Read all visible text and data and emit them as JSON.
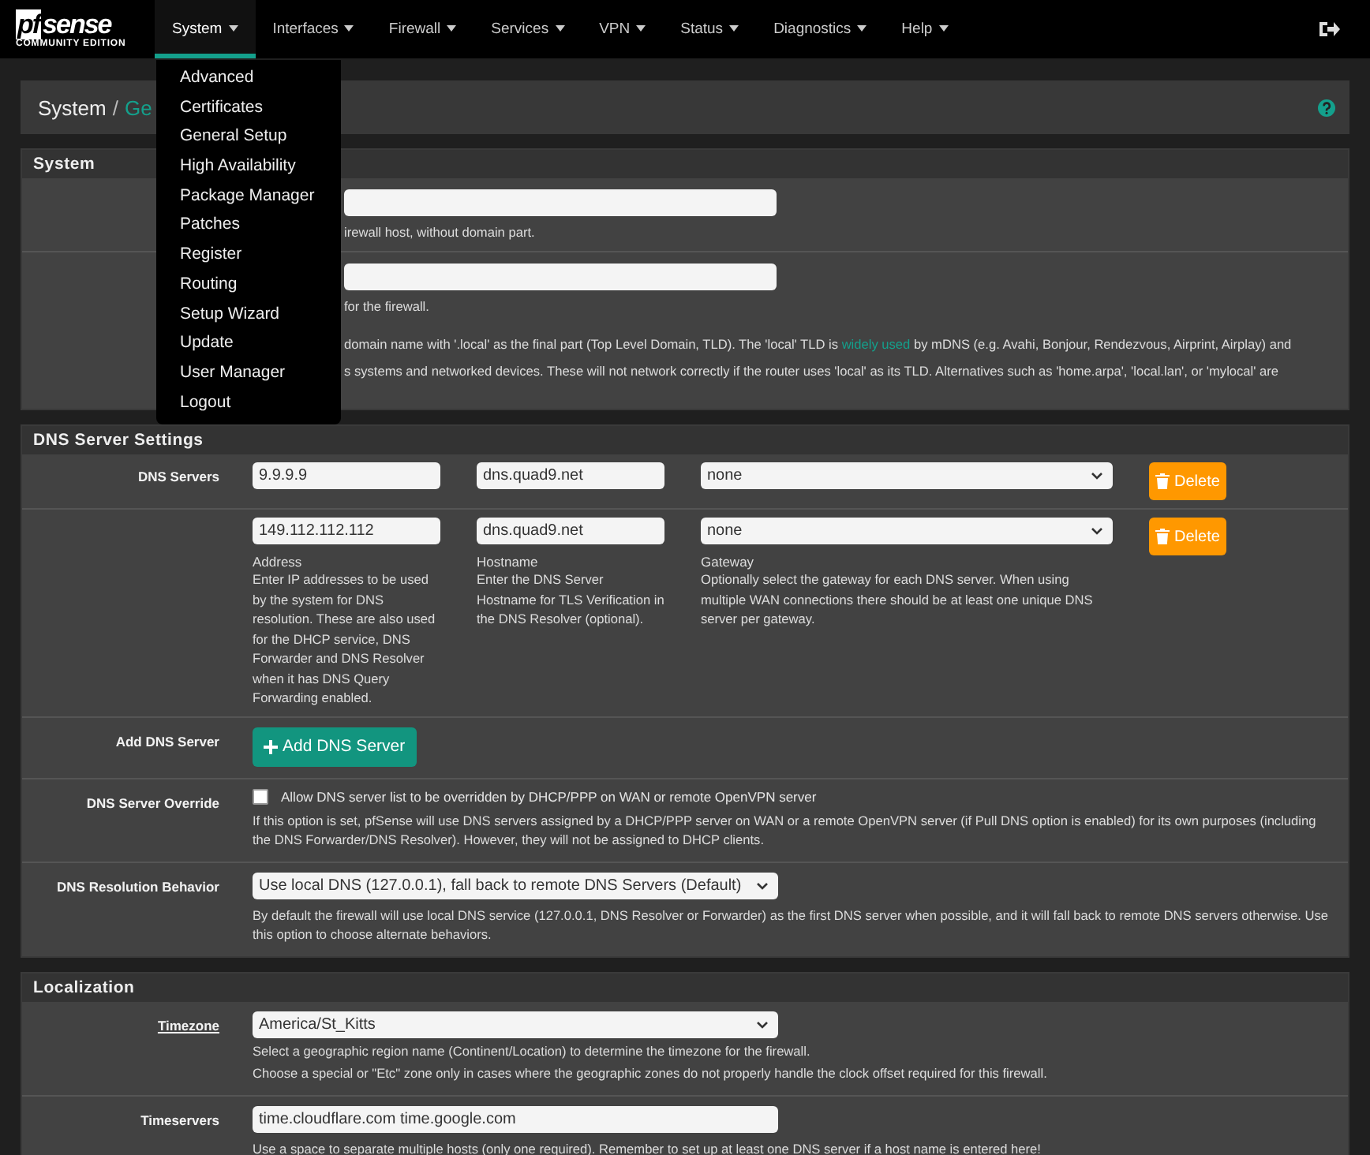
{
  "brand": {
    "logo_a": "pf",
    "logo_b": "sense",
    "edition": "COMMUNITY EDITION"
  },
  "navbar": {
    "items": [
      {
        "label": "System",
        "selected": true
      },
      {
        "label": "Interfaces",
        "selected": false
      },
      {
        "label": "Firewall",
        "selected": false
      },
      {
        "label": "Services",
        "selected": false
      },
      {
        "label": "VPN",
        "selected": false
      },
      {
        "label": "Status",
        "selected": false
      },
      {
        "label": "Diagnostics",
        "selected": false
      },
      {
        "label": "Help",
        "selected": false
      }
    ]
  },
  "menu": {
    "items": [
      "Advanced",
      "Certificates",
      "General Setup",
      "High Availability",
      "Package Manager",
      "Patches",
      "Register",
      "Routing",
      "Setup Wizard",
      "Update",
      "User Manager",
      "Logout"
    ]
  },
  "breadcrumb": {
    "root": "System",
    "sep": "/",
    "current": "Ge"
  },
  "system": {
    "title": "System",
    "hostname_help": "irewall host, without domain part.",
    "domain_help": "for the firewall.",
    "note_before": "domain name with '.local' as the final part (Top Level Domain, TLD). The 'local' TLD is ",
    "note_link": "widely used",
    "note_after": " by mDNS (e.g. Avahi, Bonjour, Rendezvous, Airprint, Airplay) and",
    "note_line2": "s systems and networked devices. These will not network correctly if the router uses 'local' as its TLD. Alternatives such as 'home.arpa', 'local.lan', or 'mylocal' are"
  },
  "dns": {
    "title": "DNS Server Settings",
    "label": "DNS Servers",
    "servers": [
      {
        "address": "9.9.9.9",
        "hostname": "dns.quad9.net",
        "gateway": "none",
        "delete": "Delete"
      },
      {
        "address": "149.112.112.112",
        "hostname": "dns.quad9.net",
        "gateway": "none",
        "delete": "Delete"
      }
    ],
    "address_title": "Address",
    "address_help": "Enter IP addresses to be used by the system for DNS resolution. These are also used for the DHCP service, DNS Forwarder and DNS Resolver when it has DNS Query Forwarding enabled.",
    "hostname_title": "Hostname",
    "hostname_help": "Enter the DNS Server Hostname for TLS Verification in the DNS Resolver (optional).",
    "gateway_title": "Gateway",
    "gateway_help": "Optionally select the gateway for each DNS server. When using multiple WAN connections there should be at least one unique DNS server per gateway.",
    "add_label": "Add DNS Server",
    "add_button": "Add DNS Server",
    "override_label": "DNS Server Override",
    "override_checked": false,
    "override_text": "Allow DNS server list to be overridden by DHCP/PPP on WAN or remote OpenVPN server",
    "override_help": "If this option is set, pfSense will use DNS servers assigned by a DHCP/PPP server on WAN or a remote OpenVPN server (if Pull DNS option is enabled) for its own purposes (including the DNS Forwarder/DNS Resolver). However, they will not be assigned to DHCP clients.",
    "behavior_label": "DNS Resolution Behavior",
    "behavior_value": "Use local DNS (127.0.0.1), fall back to remote DNS Servers (Default)",
    "behavior_help": "By default the firewall will use local DNS service (127.0.0.1, DNS Resolver or Forwarder) as the first DNS server when possible, and it will fall back to remote DNS servers otherwise. Use this option to choose alternate behaviors."
  },
  "localization": {
    "title": "Localization",
    "timezone_label": "Timezone",
    "timezone_value": "America/St_Kitts",
    "timezone_help": [
      "Select a geographic region name (Continent/Location) to determine the timezone for the firewall.",
      "Choose a special or \"Etc\" zone only in cases where the geographic zones do not properly handle the clock offset required for this firewall."
    ],
    "timeservers_label": "Timeservers",
    "timeservers_value": "time.cloudflare.com time.google.com",
    "timeservers_help": "Use a space to separate multiple hosts (only one required). Remember to set up at least one DNS server if a host name is entered here!"
  }
}
